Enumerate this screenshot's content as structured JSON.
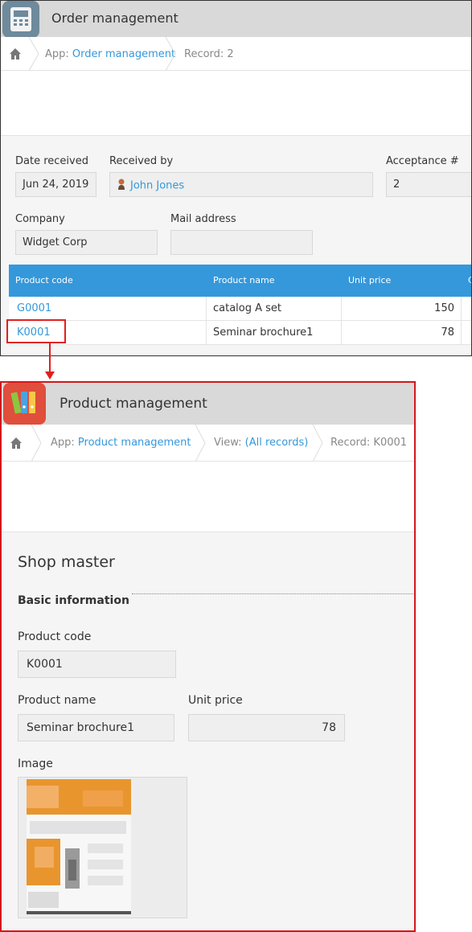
{
  "order_window": {
    "app_title": "Order management",
    "breadcrumb": {
      "app_prefix": "App:",
      "app_link": "Order management",
      "record": "Record: 2"
    },
    "fields": {
      "date_received": {
        "label": "Date received",
        "value": "Jun 24, 2019"
      },
      "received_by": {
        "label": "Received by",
        "value": "John Jones"
      },
      "acceptance": {
        "label": "Acceptance #",
        "value": "2"
      },
      "company": {
        "label": "Company",
        "value": "Widget Corp"
      },
      "mail": {
        "label": "Mail address",
        "value": ""
      }
    },
    "table": {
      "columns": [
        "Product code",
        "Product name",
        "Unit price",
        "C"
      ],
      "rows": [
        {
          "code": "G0001",
          "name": "catalog A set",
          "price": "150"
        },
        {
          "code": "K0001",
          "name": "Seminar brochure1",
          "price": "78"
        }
      ]
    }
  },
  "product_window": {
    "app_title": "Product management",
    "breadcrumb": {
      "app_prefix": "App:",
      "app_link": "Product management",
      "view_prefix": "View:",
      "view_link": "(All records)",
      "record": "Record: K0001"
    },
    "section_title": "Shop master",
    "group_title": "Basic information",
    "fields": {
      "product_code": {
        "label": "Product code",
        "value": "K0001"
      },
      "product_name": {
        "label": "Product name",
        "value": "Seminar brochure1"
      },
      "unit_price": {
        "label": "Unit price",
        "value": "78"
      },
      "image": {
        "label": "Image"
      }
    }
  },
  "colors": {
    "accent": "#3498db",
    "highlight": "#e0201e",
    "header_bg": "#d9d9d9"
  }
}
